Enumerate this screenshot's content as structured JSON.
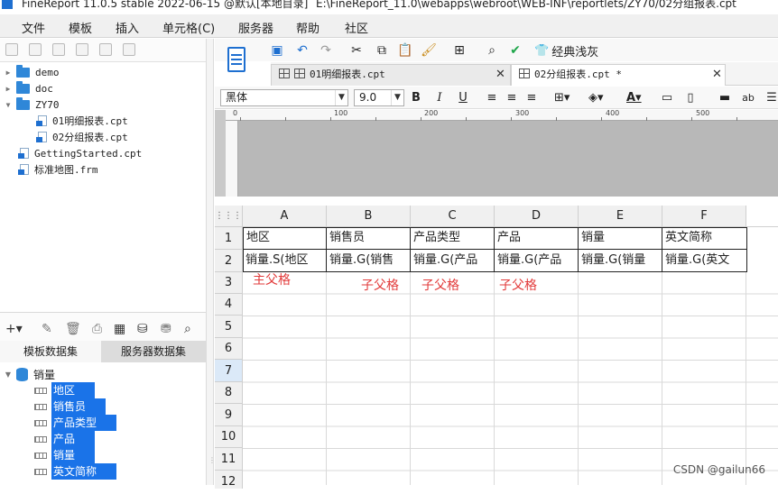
{
  "window": {
    "title": "FineReport 11.0.5 stable 2022-06-15 @默认[本地目录]",
    "path": "E:\\FineReport_11.0\\webapps\\webroot\\WEB-INF\\reportlets/ZY70/02分组报表.cpt"
  },
  "menu": [
    "文件",
    "模板",
    "插入",
    "单元格(C)",
    "服务器",
    "帮助",
    "社区"
  ],
  "file_tree": {
    "items": [
      {
        "label": "demo",
        "type": "folder"
      },
      {
        "label": "doc",
        "type": "folder"
      },
      {
        "label": "ZY70",
        "type": "folder"
      },
      {
        "label": "01明细报表.cpt",
        "type": "file"
      },
      {
        "label": "02分组报表.cpt",
        "type": "file"
      },
      {
        "label": "GettingStarted.cpt",
        "type": "file"
      },
      {
        "label": "标准地图.frm",
        "type": "file"
      }
    ]
  },
  "dataset_tabs": [
    "模板数据集",
    "服务器数据集"
  ],
  "dataset": {
    "name": "销量",
    "fields": [
      "地区",
      "销售员",
      "产品类型",
      "产品",
      "销量",
      "英文简称"
    ]
  },
  "toolbar": {
    "classic_gray": "经典浅灰"
  },
  "file_tabs": [
    {
      "label": "01明细报表.cpt",
      "active": false
    },
    {
      "label": "02分组报表.cpt *",
      "active": true
    }
  ],
  "format": {
    "font": "黑体",
    "size": "9.0"
  },
  "ruler": [
    "0",
    "100",
    "200",
    "300",
    "400",
    "500"
  ],
  "sheet": {
    "columns": [
      "A",
      "B",
      "C",
      "D",
      "E",
      "F"
    ],
    "rows": [
      "1",
      "2",
      "3",
      "4",
      "5",
      "6",
      "7",
      "8",
      "9",
      "10",
      "11",
      "12"
    ],
    "current_row": "7",
    "row1": [
      "地区",
      "销售员",
      "产品类型",
      "产品",
      "销量",
      "英文简称"
    ],
    "row2": [
      "销量.S(地区",
      "销量.G(销售",
      "销量.G(产品",
      "销量.G(产品",
      "销量.G(销量",
      "销量.G(英文"
    ],
    "annotations": [
      "主父格",
      "子父格",
      "子父格",
      "子父格"
    ]
  },
  "watermark": "CSDN @gailun66",
  "colors": {
    "accent": "#1e6fd0",
    "selection": "#1a73e8",
    "annotation": "#e23b3b"
  }
}
